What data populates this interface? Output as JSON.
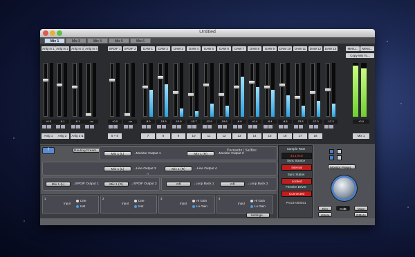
{
  "window": {
    "title": "Untitled"
  },
  "tabs": [
    {
      "label": "Mix 1",
      "active": true
    },
    {
      "label": "Mix 3",
      "active": false
    },
    {
      "label": "Mix 4",
      "active": false
    },
    {
      "label": "Mix 5",
      "active": false
    },
    {
      "label": "Mix 6",
      "active": false
    }
  ],
  "channels": [
    {
      "name": "Anlg In 1",
      "val": "+0.0",
      "level": 0.7,
      "meter": 0,
      "num": "Anlg 1"
    },
    {
      "name": "Anlg In 2",
      "val": "-6.1",
      "level": 0.6,
      "meter": 0,
      "num": "Anlg 2"
    },
    {
      "name": "Anlg In 3",
      "val": "-6.1",
      "level": 0.55,
      "meter": 0,
      "num": "Anlg 3 & 4"
    },
    {
      "name": "Anlg In 4",
      "val": "-oo",
      "level": 0.0,
      "meter": 0,
      "num": ""
    },
    {
      "name": "SPDIF 1",
      "val": "+0.0",
      "level": 0.7,
      "meter": 0,
      "num": "5 + 6"
    },
    {
      "name": "SPDIF 2",
      "val": "-oo",
      "level": 0.0,
      "meter": 0,
      "num": ""
    },
    {
      "name": "DAW 1",
      "val": "-8.0",
      "level": 0.55,
      "meter": 0.5,
      "num": "7"
    },
    {
      "name": "DAW 2",
      "val": "-13.5",
      "level": 0.75,
      "meter": 0.6,
      "num": "8"
    },
    {
      "name": "DAW 3",
      "val": "-10.5",
      "level": 0.45,
      "meter": 0.15,
      "num": "9"
    },
    {
      "name": "DAW 4",
      "val": "-15.7",
      "level": 0.4,
      "meter": 0.1,
      "num": "10"
    },
    {
      "name": "DAW 5",
      "val": "-12.9",
      "level": 0.6,
      "meter": 0.25,
      "num": "11"
    },
    {
      "name": "DAW 6",
      "val": "-19.6",
      "level": 0.4,
      "meter": 0.2,
      "num": "12"
    },
    {
      "name": "DAW 7",
      "val": "-6.0",
      "level": 0.55,
      "meter": 0.75,
      "num": "13"
    },
    {
      "name": "DAW 8",
      "val": "+0.4",
      "level": 0.65,
      "meter": 0.55,
      "num": "14"
    },
    {
      "name": "DAW 9",
      "val": "-8.4",
      "level": 0.55,
      "meter": 0.5,
      "num": "15"
    },
    {
      "name": "DAW 10",
      "val": "-8.8",
      "level": 0.6,
      "meter": 0.4,
      "num": "16"
    },
    {
      "name": "DAW 11",
      "val": "-23.5",
      "level": 0.35,
      "meter": 0.2,
      "num": "17"
    },
    {
      "name": "DAW 12",
      "val": "-17.0",
      "level": 0.45,
      "meter": 0.3,
      "num": "18"
    },
    {
      "name": "DAW 13",
      "val": "-12.3",
      "level": 0.5,
      "meter": 0.25,
      "num": ""
    },
    {
      "name": "DAW 2",
      "val": "-1.4",
      "level": 0.6,
      "meter": 0.85,
      "num": "DAW 1 & 2"
    },
    {
      "name": "DAW 3",
      "val": "-0.6",
      "level": 0.65,
      "meter": 0.75,
      "num": ""
    },
    {
      "name": "Mix 1",
      "val": "+0.0",
      "level": 0.7,
      "meter": 0.95,
      "num": "Mix 1"
    }
  ],
  "rightLabels": {
    "menu1": "Menu...",
    "menu2": "Menu...",
    "copy": "Copy Mix To..."
  },
  "routing": {
    "preset": "Routing Preset...",
    "rows": [
      {
        "src": "Mix 1 (L)",
        "dst": "Monitor Output 1",
        "src2": "Mix 1 (R)",
        "dst2": "Monitor Output 2"
      },
      {
        "src": "Mix 1 (L)",
        "dst": "Line Output 3",
        "src2": "Mix 1 (R)",
        "dst2": "Line Output 4"
      },
      {
        "src": "Mix 1 (L)",
        "dst": "SPDIF Output 1",
        "src2": "Mix 1 (R)",
        "dst2": "SPDIF Output 2"
      },
      {
        "src": "Off",
        "dst": "Loop Back 1",
        "src2": "Off",
        "dst2": "Loop Back 2"
      }
    ]
  },
  "brand": "Focusrite",
  "brandSub": "Saffire",
  "inputs": [
    {
      "num": "1",
      "label": "Input",
      "opt1": "Line",
      "opt2": "Inst"
    },
    {
      "num": "2",
      "label": "Input",
      "opt1": "Line",
      "opt2": "Inst"
    },
    {
      "num": "3",
      "label": "Input",
      "opt1": "Hi Gain",
      "opt2": "Lo Gain"
    },
    {
      "num": "4",
      "label": "Input",
      "opt1": "Hi Gain",
      "opt2": "Lo Gain"
    }
  ],
  "settingsBtn": "Settings...",
  "status": {
    "rateLabel": "Sample Rate",
    "rate": "44.1 kHz",
    "syncSourceLabel": "Sync Source",
    "syncSource": "Internal",
    "syncStatusLabel": "Sync Status",
    "syncStatus": "Locked",
    "driverLabel": "Firewire Driver",
    "driver": "Connected",
    "device": "Pro14-000031"
  },
  "monitor": {
    "preset": "Monitor Preset...",
    "dim": "Dim",
    "db": "0 dB",
    "mute": "Mute",
    "lmute": "LMute",
    "rmute": "RMute"
  },
  "colors": {
    "accent": "#2aa3e0",
    "alert": "#c21c1c",
    "tabActive": "#c9d9ee"
  }
}
